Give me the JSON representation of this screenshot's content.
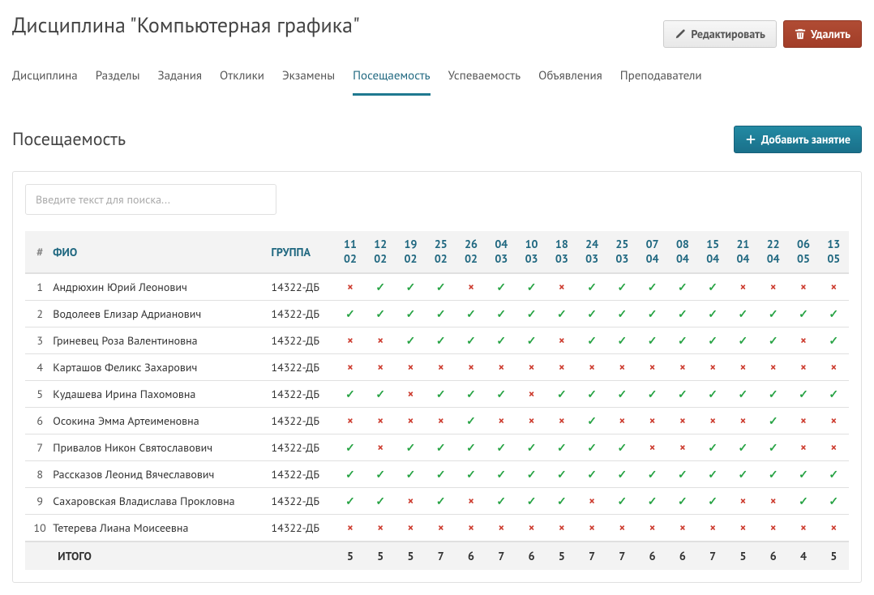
{
  "header": {
    "title": "Дисциплина \"Компьютерная графика\"",
    "edit_label": "Редактировать",
    "delete_label": "Удалить"
  },
  "tabs": [
    {
      "label": "Дисциплина",
      "active": false
    },
    {
      "label": "Разделы",
      "active": false
    },
    {
      "label": "Задания",
      "active": false
    },
    {
      "label": "Отклики",
      "active": false
    },
    {
      "label": "Экзамены",
      "active": false
    },
    {
      "label": "Посещаемость",
      "active": true
    },
    {
      "label": "Успеваемость",
      "active": false
    },
    {
      "label": "Объявления",
      "active": false
    },
    {
      "label": "Преподаватели",
      "active": false
    }
  ],
  "section": {
    "title": "Посещаемость",
    "add_label": "Добавить занятие",
    "search_placeholder": "Введите текст для поиска..."
  },
  "table": {
    "columns": {
      "num": "#",
      "name": "ФИО",
      "group": "ГРУППА"
    },
    "dates": [
      "11\n02",
      "12\n02",
      "19\n02",
      "25\n02",
      "26\n02",
      "04\n03",
      "10\n03",
      "18\n03",
      "24\n03",
      "25\n03",
      "07\n04",
      "08\n04",
      "15\n04",
      "21\n04",
      "22\n04",
      "06\n05",
      "13\n05"
    ],
    "rows": [
      {
        "num": 1,
        "name": "Андрюхин Юрий Леонович",
        "group": "14322-ДБ",
        "marks": [
          false,
          true,
          true,
          true,
          false,
          true,
          true,
          false,
          true,
          true,
          true,
          true,
          true,
          false,
          false,
          false,
          false
        ]
      },
      {
        "num": 2,
        "name": "Водолеев Елизар Адрианович",
        "group": "14322-ДБ",
        "marks": [
          true,
          true,
          true,
          true,
          true,
          true,
          true,
          true,
          true,
          true,
          true,
          true,
          true,
          true,
          true,
          true,
          true
        ]
      },
      {
        "num": 3,
        "name": "Гриневец Роза Валентиновна",
        "group": "14322-ДБ",
        "marks": [
          false,
          false,
          true,
          true,
          true,
          true,
          true,
          false,
          true,
          true,
          true,
          true,
          true,
          true,
          true,
          false,
          true
        ]
      },
      {
        "num": 4,
        "name": "Карташов Феликс Захарович",
        "group": "14322-ДБ",
        "marks": [
          false,
          false,
          false,
          false,
          false,
          false,
          false,
          false,
          false,
          false,
          false,
          false,
          false,
          false,
          false,
          false,
          false
        ]
      },
      {
        "num": 5,
        "name": "Кудашева Ирина Пахомовна",
        "group": "14322-ДБ",
        "marks": [
          true,
          true,
          false,
          true,
          true,
          true,
          false,
          true,
          true,
          true,
          true,
          true,
          true,
          true,
          true,
          true,
          true
        ]
      },
      {
        "num": 6,
        "name": "Осокина Эмма Артеименовна",
        "group": "14322-ДБ",
        "marks": [
          false,
          false,
          false,
          false,
          true,
          false,
          false,
          false,
          true,
          false,
          false,
          false,
          false,
          false,
          true,
          false,
          false
        ]
      },
      {
        "num": 7,
        "name": "Привалов Никон Святославович",
        "group": "14322-ДБ",
        "marks": [
          true,
          false,
          true,
          true,
          true,
          true,
          true,
          true,
          true,
          true,
          false,
          false,
          true,
          true,
          true,
          false,
          false
        ]
      },
      {
        "num": 8,
        "name": "Рассказов Леонид Вячеславович",
        "group": "14322-ДБ",
        "marks": [
          true,
          true,
          true,
          true,
          true,
          true,
          true,
          true,
          true,
          true,
          true,
          true,
          true,
          true,
          true,
          true,
          true
        ]
      },
      {
        "num": 9,
        "name": "Сахаровская Владислава Прокловна",
        "group": "14322-ДБ",
        "marks": [
          true,
          true,
          false,
          true,
          false,
          true,
          true,
          true,
          false,
          true,
          true,
          true,
          true,
          false,
          false,
          true,
          true
        ]
      },
      {
        "num": 10,
        "name": "Тетерева Лиана Моисеевна",
        "group": "14322-ДБ",
        "marks": [
          false,
          false,
          false,
          false,
          false,
          false,
          false,
          false,
          false,
          false,
          false,
          false,
          false,
          false,
          false,
          false,
          false
        ]
      }
    ],
    "footer": {
      "label": "ИТОГО",
      "totals": [
        "5",
        "5",
        "5",
        "7",
        "6",
        "7",
        "6",
        "5",
        "7",
        "7",
        "6",
        "6",
        "7",
        "5",
        "6",
        "4",
        "5"
      ]
    }
  }
}
